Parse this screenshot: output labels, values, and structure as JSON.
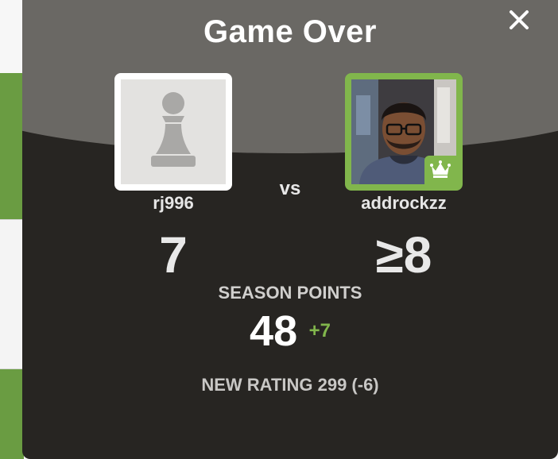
{
  "modal": {
    "title": "Game Over",
    "close_icon": "close-icon"
  },
  "players": {
    "left": {
      "username": "rj996",
      "avatar_icon": "pawn-placeholder-icon",
      "score": "7"
    },
    "right": {
      "username": "addrockzz",
      "avatar_icon": "user-photo",
      "badge_icon": "crown-icon",
      "score": "≥8"
    }
  },
  "vs_label": "vs",
  "season": {
    "label": "SEASON POINTS",
    "value": "48",
    "delta": "+7"
  },
  "rating": {
    "text": "NEW RATING 299 (-6)"
  },
  "colors": {
    "modal_bg": "#272522",
    "header_bg": "#6a6864",
    "accent_green": "#81b64c",
    "text_light": "#e8e8e8"
  }
}
